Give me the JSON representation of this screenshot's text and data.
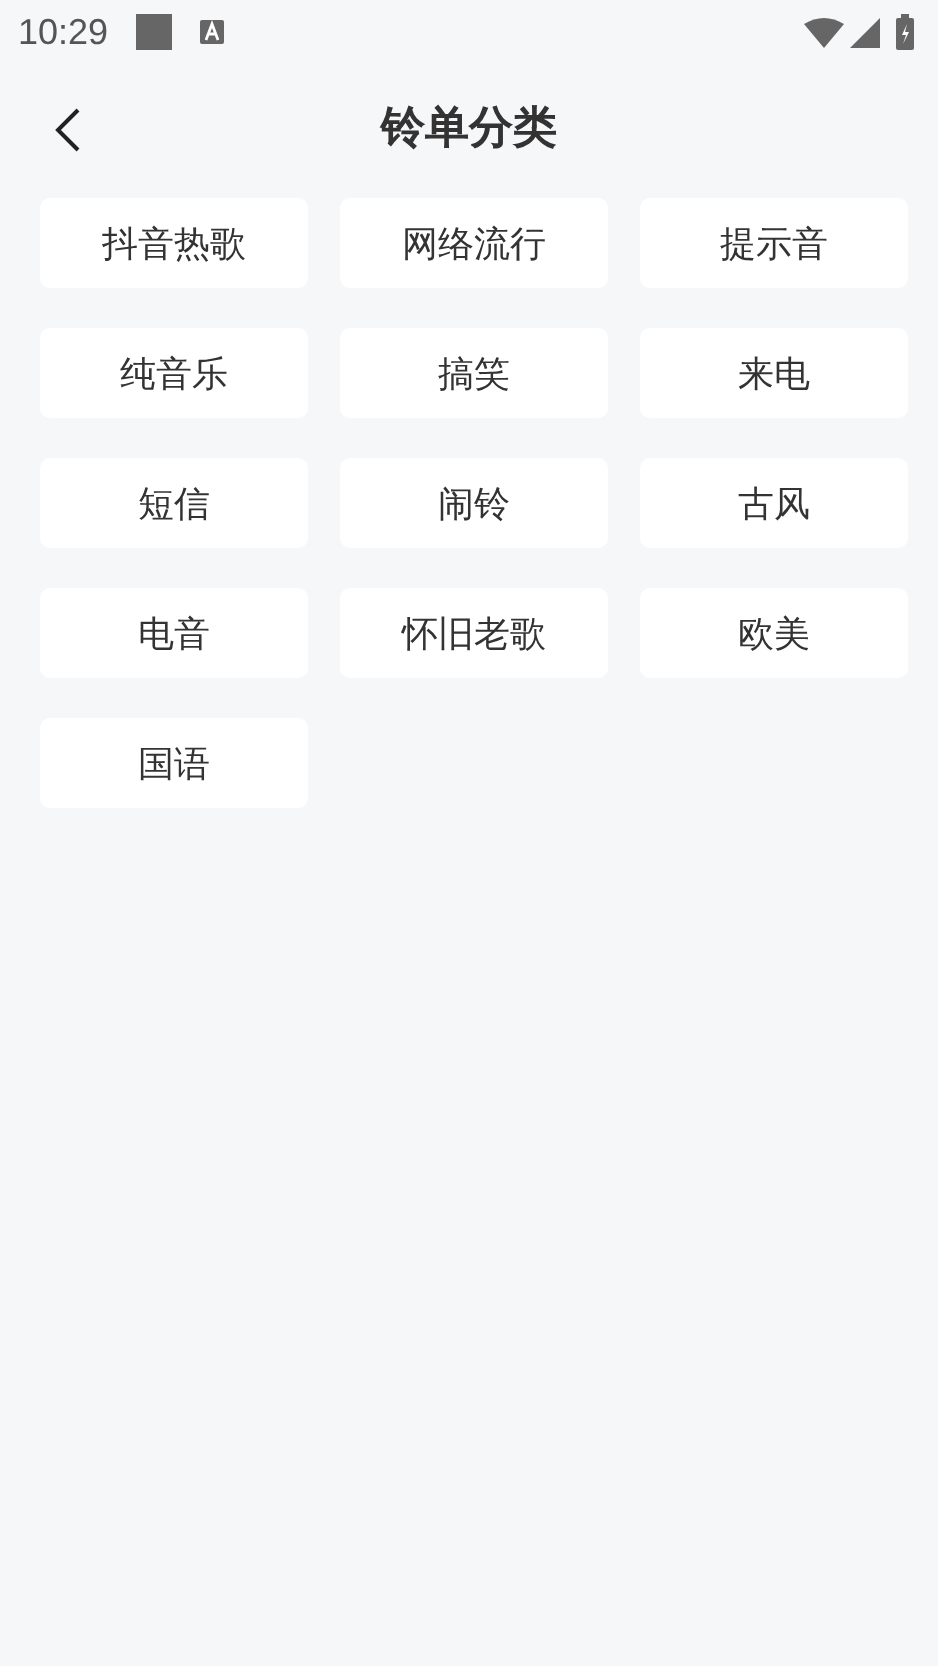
{
  "status_bar": {
    "time": "10:29"
  },
  "header": {
    "title": "铃单分类"
  },
  "categories": [
    {
      "label": "抖音热歌"
    },
    {
      "label": "网络流行"
    },
    {
      "label": "提示音"
    },
    {
      "label": "纯音乐"
    },
    {
      "label": "搞笑"
    },
    {
      "label": "来电"
    },
    {
      "label": "短信"
    },
    {
      "label": "闹铃"
    },
    {
      "label": "古风"
    },
    {
      "label": "电音"
    },
    {
      "label": "怀旧老歌"
    },
    {
      "label": "欧美"
    },
    {
      "label": "国语"
    }
  ]
}
